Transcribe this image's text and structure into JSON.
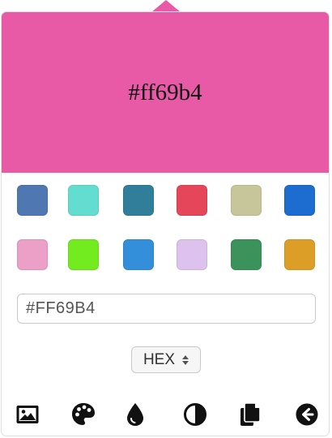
{
  "preview": {
    "text": "#ff69b4",
    "color": "#e85aa5"
  },
  "swatches": [
    "#4f78b2",
    "#63ddd0",
    "#317e9a",
    "#e54659",
    "#c7c69a",
    "#1c6dcf",
    "#eca0c8",
    "#72eb1f",
    "#348fdb",
    "#dcc2ec",
    "#3b935b",
    "#dc9e26"
  ],
  "hex_input": {
    "value": "#FF69B4"
  },
  "format_select": {
    "selected": "HEX"
  },
  "toolbar": {
    "icons": [
      "image-icon",
      "palette-icon",
      "drop-icon",
      "contrast-icon",
      "copy-icon",
      "back-icon"
    ]
  }
}
